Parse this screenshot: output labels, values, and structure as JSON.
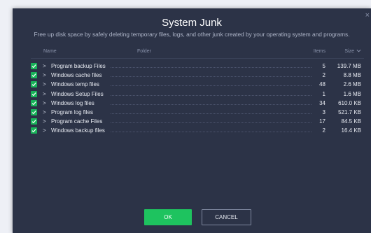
{
  "dialog": {
    "title": "System Junk",
    "subtitle": "Free up disk space by safely deleting temporary files, logs, and other junk created by your operating system and programs.",
    "close_glyph": "×"
  },
  "table": {
    "headers": {
      "name": "Name",
      "folder": "Folder",
      "items": "Items",
      "size": "Size"
    },
    "sort_icon": "chevron-down-icon",
    "rows": [
      {
        "name": "Program backup Files",
        "items": "5",
        "size": "139.7 MB",
        "checked": true
      },
      {
        "name": "Windows cache files",
        "items": "2",
        "size": "8.8 MB",
        "checked": true
      },
      {
        "name": "Windows temp files",
        "items": "48",
        "size": "2.6 MB",
        "checked": true
      },
      {
        "name": "Windows Setup Files",
        "items": "1",
        "size": "1.6 MB",
        "checked": true
      },
      {
        "name": "Windows log files",
        "items": "34",
        "size": "610.0 KB",
        "checked": true
      },
      {
        "name": "Program log files",
        "items": "3",
        "size": "521.7 KB",
        "checked": true
      },
      {
        "name": "Program cache Files",
        "items": "17",
        "size": "84.5 KB",
        "checked": true
      },
      {
        "name": "Windows backup files",
        "items": "2",
        "size": "16.4 KB",
        "checked": true
      }
    ]
  },
  "buttons": {
    "ok": "OK",
    "cancel": "CANCEL"
  },
  "colors": {
    "accent": "#1ec35f",
    "dialog_bg": "#2c3347",
    "page_bg": "#eef0f6"
  }
}
